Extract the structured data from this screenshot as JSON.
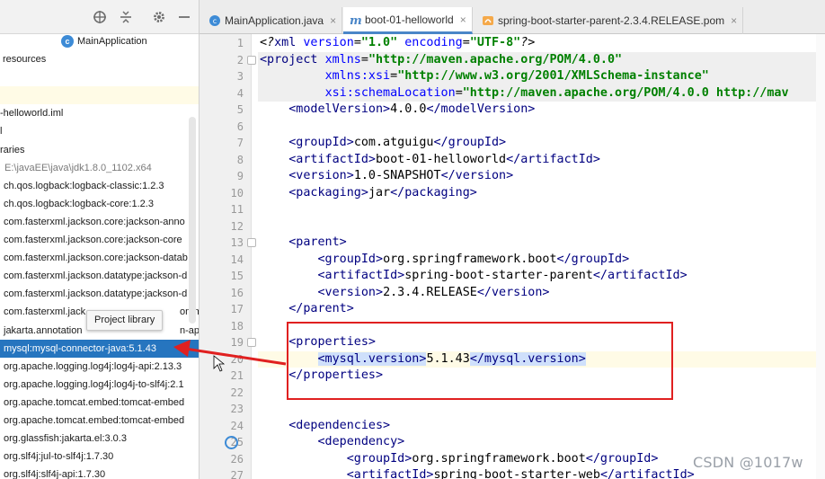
{
  "project_panel": {
    "toolbar_icons": [
      "globe-crosshair-icon",
      "collapse-icon",
      "gear-icon",
      "minimize-icon"
    ],
    "tree": [
      {
        "label": "MainApplication",
        "icon": "class-icon",
        "indent": 68
      },
      {
        "label": "resources",
        "indent": 3
      },
      {
        "label": "",
        "indent": 0
      },
      {
        "label": "",
        "indent": 0,
        "highlight": true
      },
      {
        "label": "-helloworld.iml",
        "indent": 0
      },
      {
        "label": "l",
        "indent": 0
      },
      {
        "label": "raries",
        "indent": 0
      },
      {
        "label": "E:\\javaEE\\java\\jdk1.8.0_1102.x64",
        "indent": 5,
        "gray": true
      },
      {
        "label": "ch.qos.logback:logback-classic:1.2.3",
        "indent": 4
      },
      {
        "label": "ch.qos.logback:logback-core:1.2.3",
        "indent": 4
      },
      {
        "label": "com.fasterxml.jackson.core:jackson-anno",
        "indent": 4
      },
      {
        "label": "com.fasterxml.jackson.core:jackson-core",
        "indent": 4
      },
      {
        "label": "com.fasterxml.jackson.core:jackson-datab",
        "indent": 4
      },
      {
        "label": "com.fasterxml.jackson.datatype:jackson-d",
        "indent": 4
      },
      {
        "label": "com.fasterxml.jackson.datatype:jackson-d",
        "indent": 4
      },
      {
        "label": "com.fasterxml.jack",
        "indent": 4,
        "tail": "on-m"
      },
      {
        "label": "jakarta.annotation",
        "indent": 4,
        "tail": "n-api:"
      },
      {
        "label": "mysql:mysql-connector-java:5.1.43",
        "indent": 4,
        "selected": true
      },
      {
        "label": "org.apache.logging.log4j:log4j-api:2.13.3",
        "indent": 4
      },
      {
        "label": "org.apache.logging.log4j:log4j-to-slf4j:2.1",
        "indent": 4
      },
      {
        "label": "org.apache.tomcat.embed:tomcat-embed",
        "indent": 4
      },
      {
        "label": "org.apache.tomcat.embed:tomcat-embed",
        "indent": 4
      },
      {
        "label": "org.glassfish:jakarta.el:3.0.3",
        "indent": 4
      },
      {
        "label": "org.slf4j:jul-to-slf4j:1.7.30",
        "indent": 4
      },
      {
        "label": "org.slf4j:slf4j-api:1.7.30",
        "indent": 4
      }
    ],
    "tooltip": "Project library"
  },
  "tabs": [
    {
      "label": "MainApplication.java",
      "icon": "class-icon",
      "active": false
    },
    {
      "label": "boot-01-helloworld",
      "icon": "maven-icon",
      "active": true
    },
    {
      "label": "spring-boot-starter-parent-2.3.4.RELEASE.pom",
      "icon": "pom-icon",
      "active": false
    }
  ],
  "tab_close_glyph": "×",
  "editor": {
    "line_numbers": [
      "1",
      "2",
      "3",
      "4",
      "5",
      "6",
      "7",
      "8",
      "9",
      "10",
      "11",
      "12",
      "13",
      "14",
      "15",
      "16",
      "17",
      "18",
      "19",
      "20",
      "21",
      "22",
      "23",
      "24",
      "25",
      "26",
      "27"
    ],
    "lines": [
      [
        {
          "c": "p",
          "t": "<?"
        },
        {
          "c": "t",
          "t": "xml "
        },
        {
          "c": "a",
          "t": "version"
        },
        {
          "c": "",
          "t": "="
        },
        {
          "c": "s",
          "t": "\"1.0\" "
        },
        {
          "c": "a",
          "t": "encoding"
        },
        {
          "c": "",
          "t": "="
        },
        {
          "c": "s",
          "t": "\"UTF-8\""
        },
        {
          "c": "p",
          "t": "?>"
        }
      ],
      [
        {
          "c": "t",
          "t": "<project "
        },
        {
          "c": "a",
          "t": "xmlns"
        },
        {
          "c": "",
          "t": "="
        },
        {
          "c": "s",
          "t": "\"http://maven.apache.org/POM/4.0.0\""
        }
      ],
      [
        {
          "c": "",
          "t": "         "
        },
        {
          "c": "a",
          "t": "xmlns:xsi"
        },
        {
          "c": "",
          "t": "="
        },
        {
          "c": "s",
          "t": "\"http://www.w3.org/2001/XMLSchema-instance\""
        }
      ],
      [
        {
          "c": "",
          "t": "         "
        },
        {
          "c": "a",
          "t": "xsi:schemaLocation"
        },
        {
          "c": "",
          "t": "="
        },
        {
          "c": "s",
          "t": "\"http://maven.apache.org/POM/4.0.0 http://mav"
        }
      ],
      [
        {
          "c": "",
          "t": "    "
        },
        {
          "c": "t",
          "t": "<modelVersion>"
        },
        {
          "c": "",
          "t": "4.0.0"
        },
        {
          "c": "t",
          "t": "</modelVersion>"
        }
      ],
      [],
      [
        {
          "c": "",
          "t": "    "
        },
        {
          "c": "t",
          "t": "<groupId>"
        },
        {
          "c": "",
          "t": "com.atguigu"
        },
        {
          "c": "t",
          "t": "</groupId>"
        }
      ],
      [
        {
          "c": "",
          "t": "    "
        },
        {
          "c": "t",
          "t": "<artifactId>"
        },
        {
          "c": "",
          "t": "boot-01-helloworld"
        },
        {
          "c": "t",
          "t": "</artifactId>"
        }
      ],
      [
        {
          "c": "",
          "t": "    "
        },
        {
          "c": "t",
          "t": "<version>"
        },
        {
          "c": "",
          "t": "1.0-SNAPSHOT"
        },
        {
          "c": "t",
          "t": "</version>"
        }
      ],
      [
        {
          "c": "",
          "t": "    "
        },
        {
          "c": "t",
          "t": "<packaging>"
        },
        {
          "c": "",
          "t": "jar"
        },
        {
          "c": "t",
          "t": "</packaging>"
        }
      ],
      [],
      [],
      [
        {
          "c": "",
          "t": "    "
        },
        {
          "c": "t",
          "t": "<parent>"
        }
      ],
      [
        {
          "c": "",
          "t": "        "
        },
        {
          "c": "t",
          "t": "<groupId>"
        },
        {
          "c": "",
          "t": "org.springframework.boot"
        },
        {
          "c": "t",
          "t": "</groupId>"
        }
      ],
      [
        {
          "c": "",
          "t": "        "
        },
        {
          "c": "t",
          "t": "<artifactId>"
        },
        {
          "c": "",
          "t": "spring-boot-starter-parent"
        },
        {
          "c": "t",
          "t": "</artifactId>"
        }
      ],
      [
        {
          "c": "",
          "t": "        "
        },
        {
          "c": "t",
          "t": "<version>"
        },
        {
          "c": "",
          "t": "2.3.4.RELEASE"
        },
        {
          "c": "t",
          "t": "</version>"
        }
      ],
      [
        {
          "c": "",
          "t": "    "
        },
        {
          "c": "t",
          "t": "</parent>"
        }
      ],
      [],
      [
        {
          "c": "",
          "t": "    "
        },
        {
          "c": "t",
          "t": "<properties>"
        }
      ],
      [
        {
          "c": "",
          "t": "        "
        },
        {
          "c": "t mh",
          "t": "<mysql.version>"
        },
        {
          "c": "",
          "t": "5.1.43"
        },
        {
          "c": "t mh",
          "t": "</mysql.version>"
        }
      ],
      [
        {
          "c": "",
          "t": "    "
        },
        {
          "c": "t",
          "t": "</properties>"
        }
      ],
      [],
      [],
      [
        {
          "c": "",
          "t": "    "
        },
        {
          "c": "t",
          "t": "<dependencies>"
        }
      ],
      [
        {
          "c": "",
          "t": "        "
        },
        {
          "c": "t",
          "t": "<dependency>"
        }
      ],
      [
        {
          "c": "",
          "t": "            "
        },
        {
          "c": "t",
          "t": "<groupId>"
        },
        {
          "c": "",
          "t": "org.springframework.boot"
        },
        {
          "c": "t",
          "t": "</groupId>"
        }
      ],
      [
        {
          "c": "",
          "t": "            "
        },
        {
          "c": "t",
          "t": "<artifactId>"
        },
        {
          "c": "",
          "t": "spring-boot-starter-web"
        },
        {
          "c": "t",
          "t": "</artifactId>"
        }
      ]
    ],
    "current_line": 20
  },
  "watermark": "CSDN @1017w",
  "colors": {
    "selection": "#2675bf",
    "annotation_red": "#e02020",
    "tag": "#000080",
    "attribute": "#0000ff",
    "string": "#008000"
  }
}
